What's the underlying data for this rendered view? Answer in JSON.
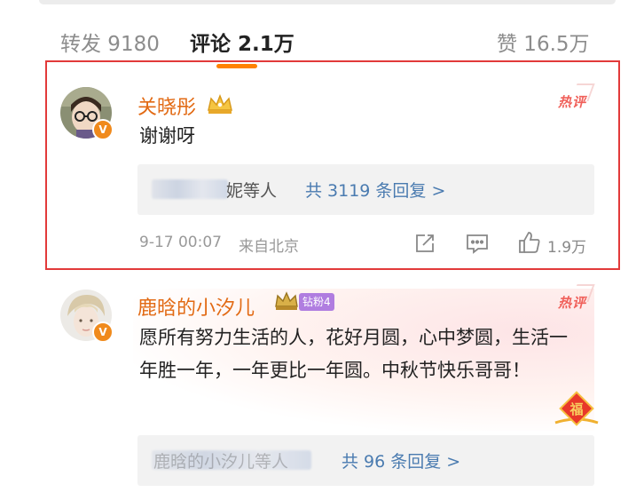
{
  "tabs": {
    "repost": "转发 9180",
    "comments": "评论 2.1万",
    "likes": "赞 16.5万"
  },
  "comments": [
    {
      "username": "关晓彤",
      "hot_tag": "热评",
      "text": "谢谢呀",
      "reply_names": "妮等人",
      "reply_count": "共 3119 条回复 >",
      "time": "9-17 00:07",
      "location": "来自北京",
      "likes": "1.9万"
    },
    {
      "username": "鹿晗的小汐儿",
      "fan_badge": "钻粉4",
      "hot_tag": "热评",
      "text": "愿所有努力生活的人，花好月圆，心中梦圆，生活一年胜一年，一年更比一年圆。中秋节快乐哥哥！",
      "reply_names": "鹿晗的小汐儿等人",
      "reply_count": "共 96 条回复 >"
    }
  ],
  "icons": [
    "crown-icon",
    "verified-icon",
    "share-icon",
    "comment-icon",
    "like-icon",
    "fu-sticker-icon"
  ],
  "colors": {
    "accent": "#ff8200",
    "username": "#e26a14",
    "link": "#4a7bb0",
    "highlight": "#e23a3a"
  }
}
